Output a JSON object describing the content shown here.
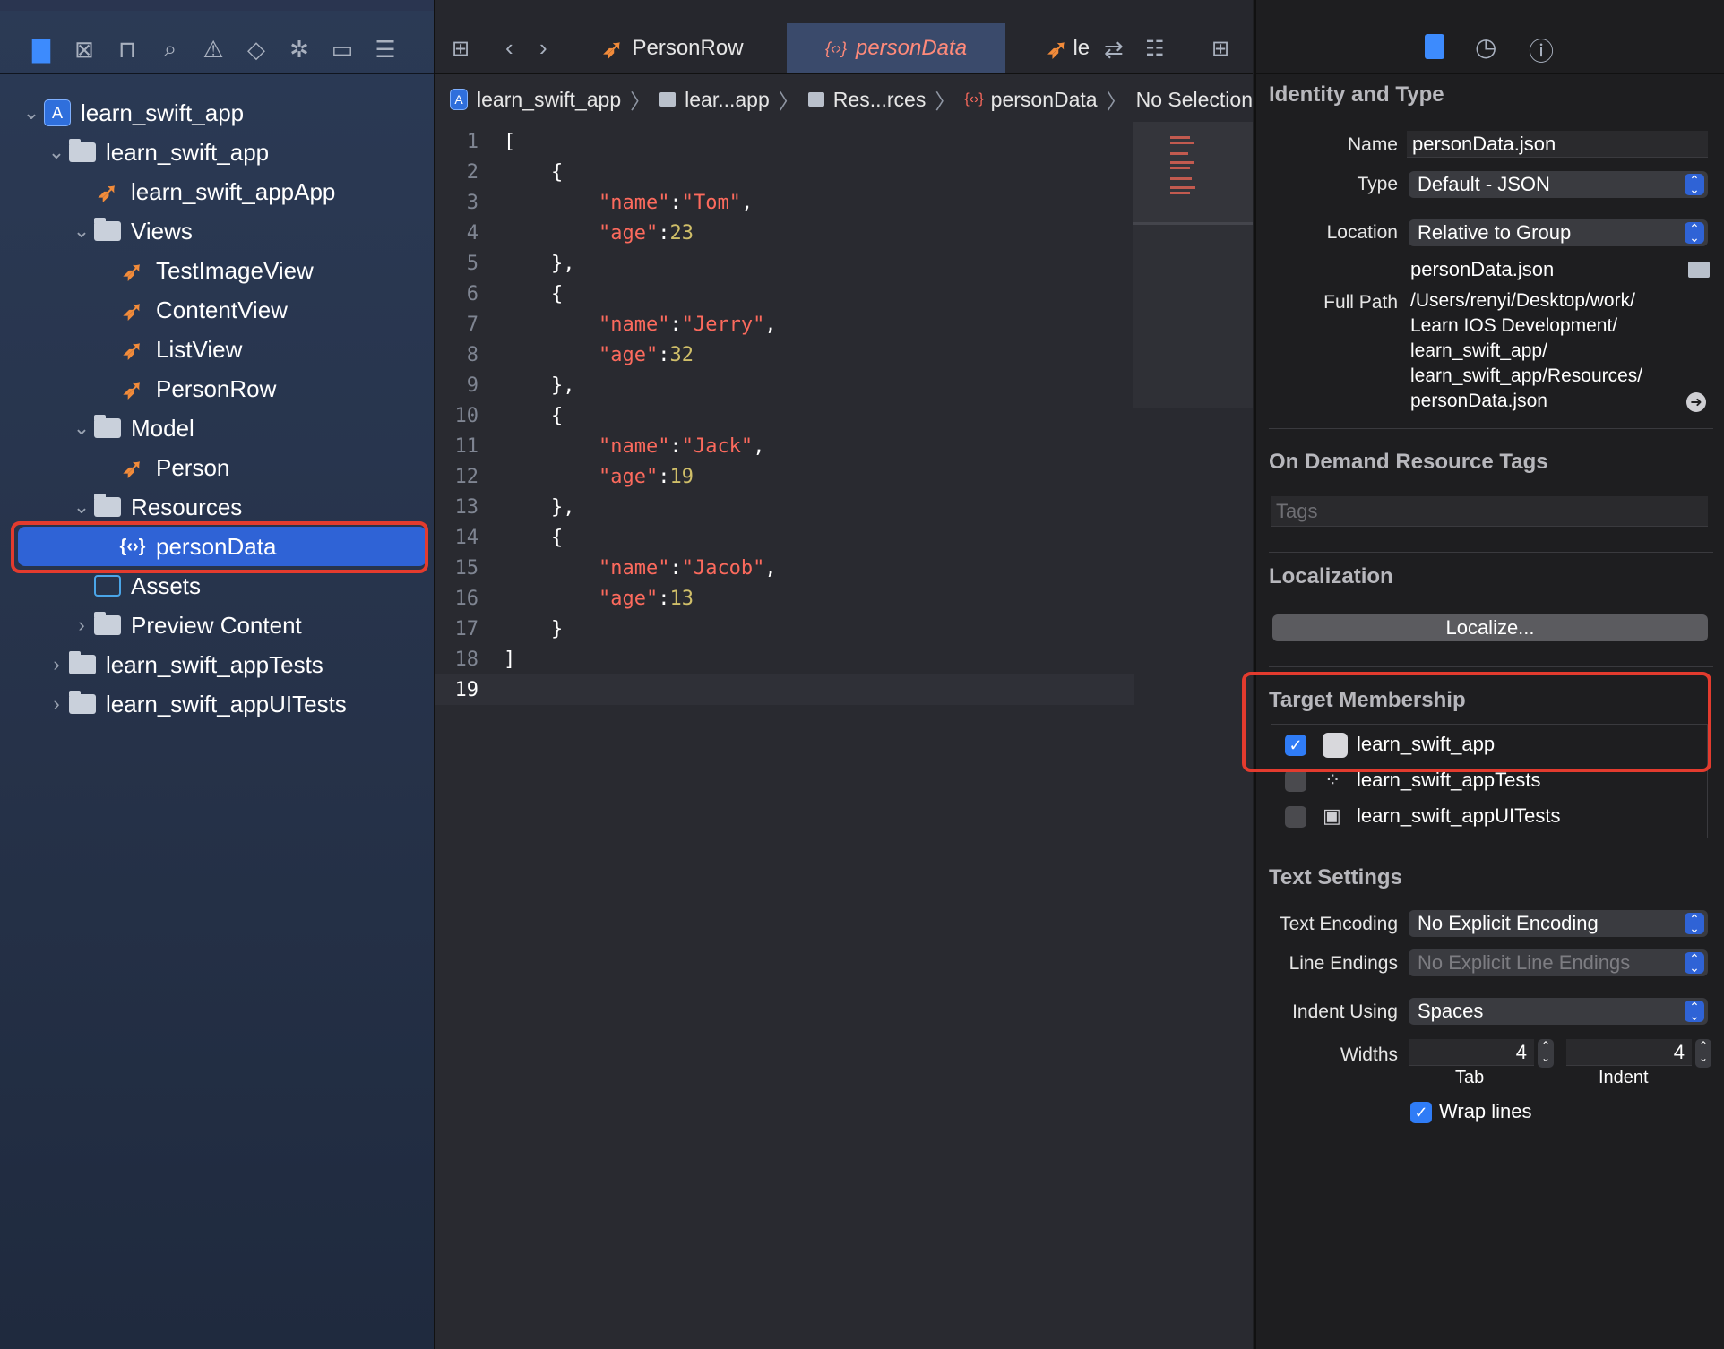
{
  "navigator": {
    "tree": [
      {
        "label": "learn_swift_app",
        "icon": "project-icon",
        "chevron": "v",
        "level": 0
      },
      {
        "label": "learn_swift_app",
        "icon": "folder-icon",
        "chevron": "v",
        "level": 1
      },
      {
        "label": "learn_swift_appApp",
        "icon": "swift-file-icon",
        "chevron": "",
        "level": 2
      },
      {
        "label": "Views",
        "icon": "folder-icon",
        "chevron": "v",
        "level": 2
      },
      {
        "label": "TestImageView",
        "icon": "swift-file-icon",
        "chevron": "",
        "level": 3
      },
      {
        "label": "ContentView",
        "icon": "swift-file-icon",
        "chevron": "",
        "level": 3
      },
      {
        "label": "ListView",
        "icon": "swift-file-icon",
        "chevron": "",
        "level": 3
      },
      {
        "label": "PersonRow",
        "icon": "swift-file-icon",
        "chevron": "",
        "level": 3
      },
      {
        "label": "Model",
        "icon": "folder-icon",
        "chevron": "v",
        "level": 2
      },
      {
        "label": "Person",
        "icon": "swift-file-icon",
        "chevron": "",
        "level": 3
      },
      {
        "label": "Resources",
        "icon": "folder-icon",
        "chevron": "v",
        "level": 2
      },
      {
        "label": "personData",
        "icon": "json-file-icon",
        "chevron": "",
        "level": 3,
        "selected": true
      },
      {
        "label": "Assets",
        "icon": "assets-icon",
        "chevron": "",
        "level": 2
      },
      {
        "label": "Preview Content",
        "icon": "folder-icon",
        "chevron": ">",
        "level": 2
      },
      {
        "label": "learn_swift_appTests",
        "icon": "folder-icon",
        "chevron": ">",
        "level": 1
      },
      {
        "label": "learn_swift_appUITests",
        "icon": "folder-icon",
        "chevron": ">",
        "level": 1
      }
    ]
  },
  "editor": {
    "tabs": {
      "tab1": "PersonRow",
      "tab2": "personData",
      "tab3": "le"
    },
    "breadcrumb": {
      "b1": "learn_swift_app",
      "b2": "lear...app",
      "b3": "Res...rces",
      "b4": "personData",
      "b5": "No Selection"
    },
    "lines": [
      "[",
      "    {",
      "        \"name\":\"Tom\",",
      "        \"age\":23",
      "    },",
      "    {",
      "        \"name\":\"Jerry\",",
      "        \"age\":32",
      "    },",
      "    {",
      "        \"name\":\"Jack\",",
      "        \"age\":19",
      "    },",
      "    {",
      "        \"name\":\"Jacob\",",
      "        \"age\":13",
      "    }",
      "]",
      ""
    ]
  },
  "inspector": {
    "identity": {
      "title": "Identity and Type",
      "name_label": "Name",
      "name_value": "personData.json",
      "type_label": "Type",
      "type_value": "Default - JSON",
      "location_label": "Location",
      "location_value": "Relative to Group",
      "location_file": "personData.json",
      "fullpath_label": "Full Path",
      "fullpath_1": "/Users/renyi/Desktop/work/",
      "fullpath_2": "Learn IOS Development/",
      "fullpath_3": "learn_swift_app/",
      "fullpath_4": "learn_swift_app/Resources/",
      "fullpath_5": "personData.json"
    },
    "ondemand": {
      "title": "On Demand Resource Tags",
      "placeholder": "Tags"
    },
    "localization": {
      "title": "Localization",
      "button": "Localize..."
    },
    "target": {
      "title": "Target Membership",
      "t1": "learn_swift_app",
      "t2": "learn_swift_appTests",
      "t3": "learn_swift_appUITests"
    },
    "text_settings": {
      "title": "Text Settings",
      "encoding_label": "Text Encoding",
      "encoding_value": "No Explicit Encoding",
      "endings_label": "Line Endings",
      "endings_value": "No Explicit Line Endings",
      "indent_label": "Indent Using",
      "indent_value": "Spaces",
      "widths_label": "Widths",
      "tab_value": "4",
      "indent_width_value": "4",
      "tab_caption": "Tab",
      "indent_caption": "Indent",
      "wrap_label": "Wrap lines"
    }
  }
}
